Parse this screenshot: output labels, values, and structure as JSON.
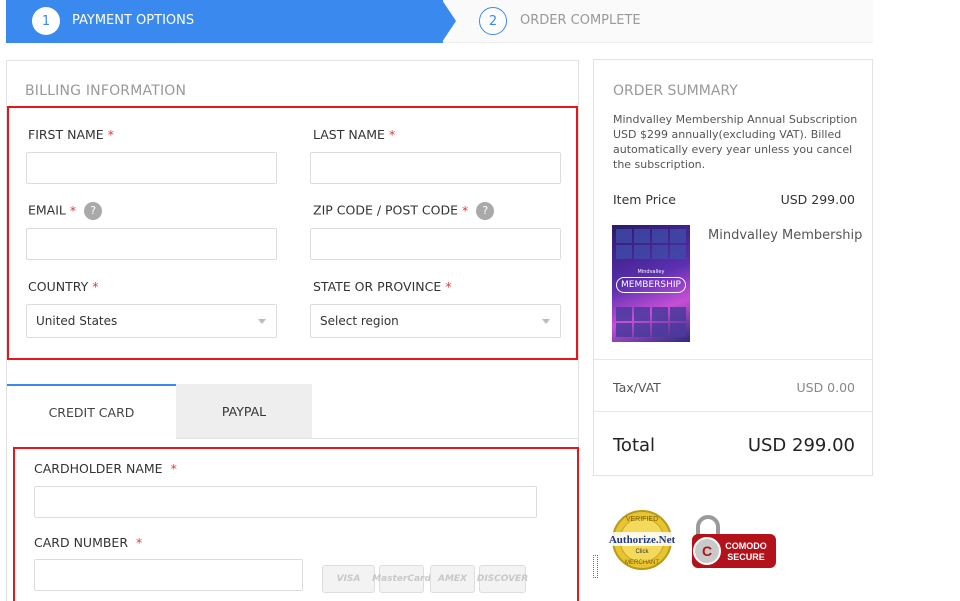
{
  "steps": [
    {
      "number": "1",
      "label": "PAYMENT OPTIONS"
    },
    {
      "number": "2",
      "label": "ORDER COMPLETE"
    }
  ],
  "billing": {
    "heading": "BILLING INFORMATION",
    "first_name_label": "FIRST NAME",
    "last_name_label": "LAST NAME",
    "email_label": "EMAIL",
    "zip_label": "ZIP CODE / POST CODE",
    "country_label": "COUNTRY",
    "country_value": "United States",
    "state_label": "STATE OR PROVINCE",
    "state_value": "Select region",
    "required_mark": "*",
    "help_mark": "?"
  },
  "tabs": {
    "credit_card": "CREDIT CARD",
    "paypal": "PAYPAL"
  },
  "card": {
    "holder_label": "CARDHOLDER NAME",
    "number_label": "CARD NUMBER",
    "logos": [
      "VISA",
      "MasterCard",
      "AMEX",
      "DISCOVER"
    ]
  },
  "summary": {
    "title": "ORDER SUMMARY",
    "description": "Mindvalley Membership Annual Subscription USD $299 annually(excluding VAT). Billed automatically every year unless you cancel the subscription.",
    "item_price_label": "Item Price",
    "item_price_value": "USD 299.00",
    "product_name": "Mindvalley Membership",
    "thumb_top": "Mindvalley",
    "thumb_main": "MEMBERSHIP",
    "tax_label": "Tax/VAT",
    "tax_value": "USD 0.00",
    "total_label": "Total",
    "total_value": "USD 299.00"
  },
  "badges": {
    "authorize_top": "VERIFIED",
    "authorize_name": "Authorize.Net",
    "authorize_click": "Click",
    "authorize_bottom": "MERCHANT",
    "comodo_line1": "COMODO",
    "comodo_line2": "SECURE"
  },
  "colors": {
    "accent": "#3a89ef",
    "highlight": "#e8151b",
    "required": "#e13b3b"
  }
}
